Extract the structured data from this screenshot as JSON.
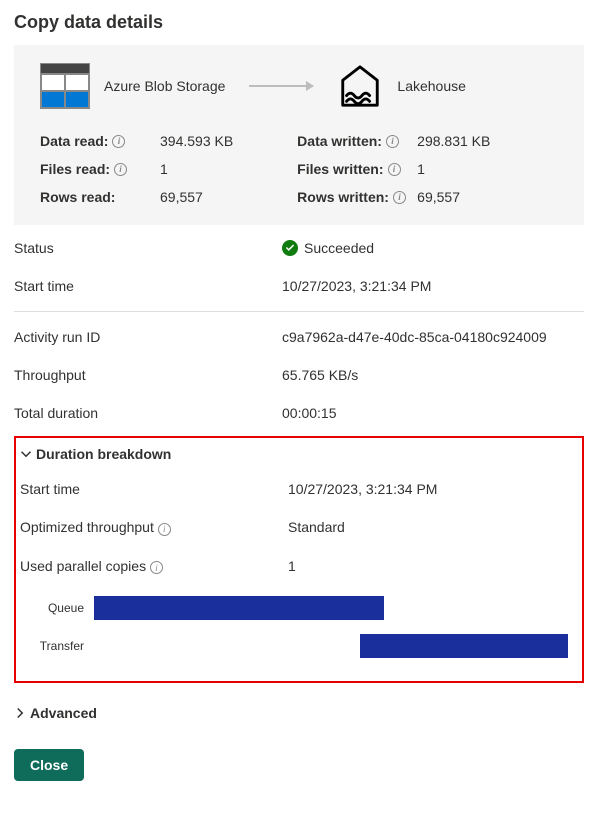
{
  "title": "Copy data details",
  "source": {
    "label": "Azure Blob Storage"
  },
  "sink": {
    "label": "Lakehouse"
  },
  "stats": {
    "data_read_label": "Data read:",
    "data_read": "394.593 KB",
    "files_read_label": "Files read:",
    "files_read": "1",
    "rows_read_label": "Rows read:",
    "rows_read": "69,557",
    "data_written_label": "Data written:",
    "data_written": "298.831 KB",
    "files_written_label": "Files written:",
    "files_written": "1",
    "rows_written_label": "Rows written:",
    "rows_written": "69,557"
  },
  "summary": {
    "status_label": "Status",
    "status_value": "Succeeded",
    "start_time_label": "Start time",
    "start_time_value": "10/27/2023, 3:21:34 PM",
    "activity_run_id_label": "Activity run ID",
    "activity_run_id_value": "c9a7962a-d47e-40dc-85ca-04180c924009",
    "throughput_label": "Throughput",
    "throughput_value": "65.765 KB/s",
    "total_duration_label": "Total duration",
    "total_duration_value": "00:00:15"
  },
  "breakdown": {
    "header": "Duration breakdown",
    "start_time_label": "Start time",
    "start_time_value": "10/27/2023, 3:21:34 PM",
    "optimized_throughput_label": "Optimized throughput",
    "optimized_throughput_value": "Standard",
    "used_parallel_copies_label": "Used parallel copies",
    "used_parallel_copies_value": "1",
    "gantt": {
      "rows": [
        {
          "label": "Queue",
          "start_pct": 0,
          "width_pct": 60
        },
        {
          "label": "Transfer",
          "start_pct": 55,
          "width_pct": 43
        }
      ]
    }
  },
  "advanced_label": "Advanced",
  "close_label": "Close",
  "chart_data": {
    "type": "bar",
    "orientation": "horizontal-gantt",
    "title": "Duration breakdown",
    "x_units": "percent of total duration (00:00:15)",
    "series": [
      {
        "name": "Queue",
        "start": 0,
        "width": 60
      },
      {
        "name": "Transfer",
        "start": 55,
        "width": 43
      }
    ]
  }
}
